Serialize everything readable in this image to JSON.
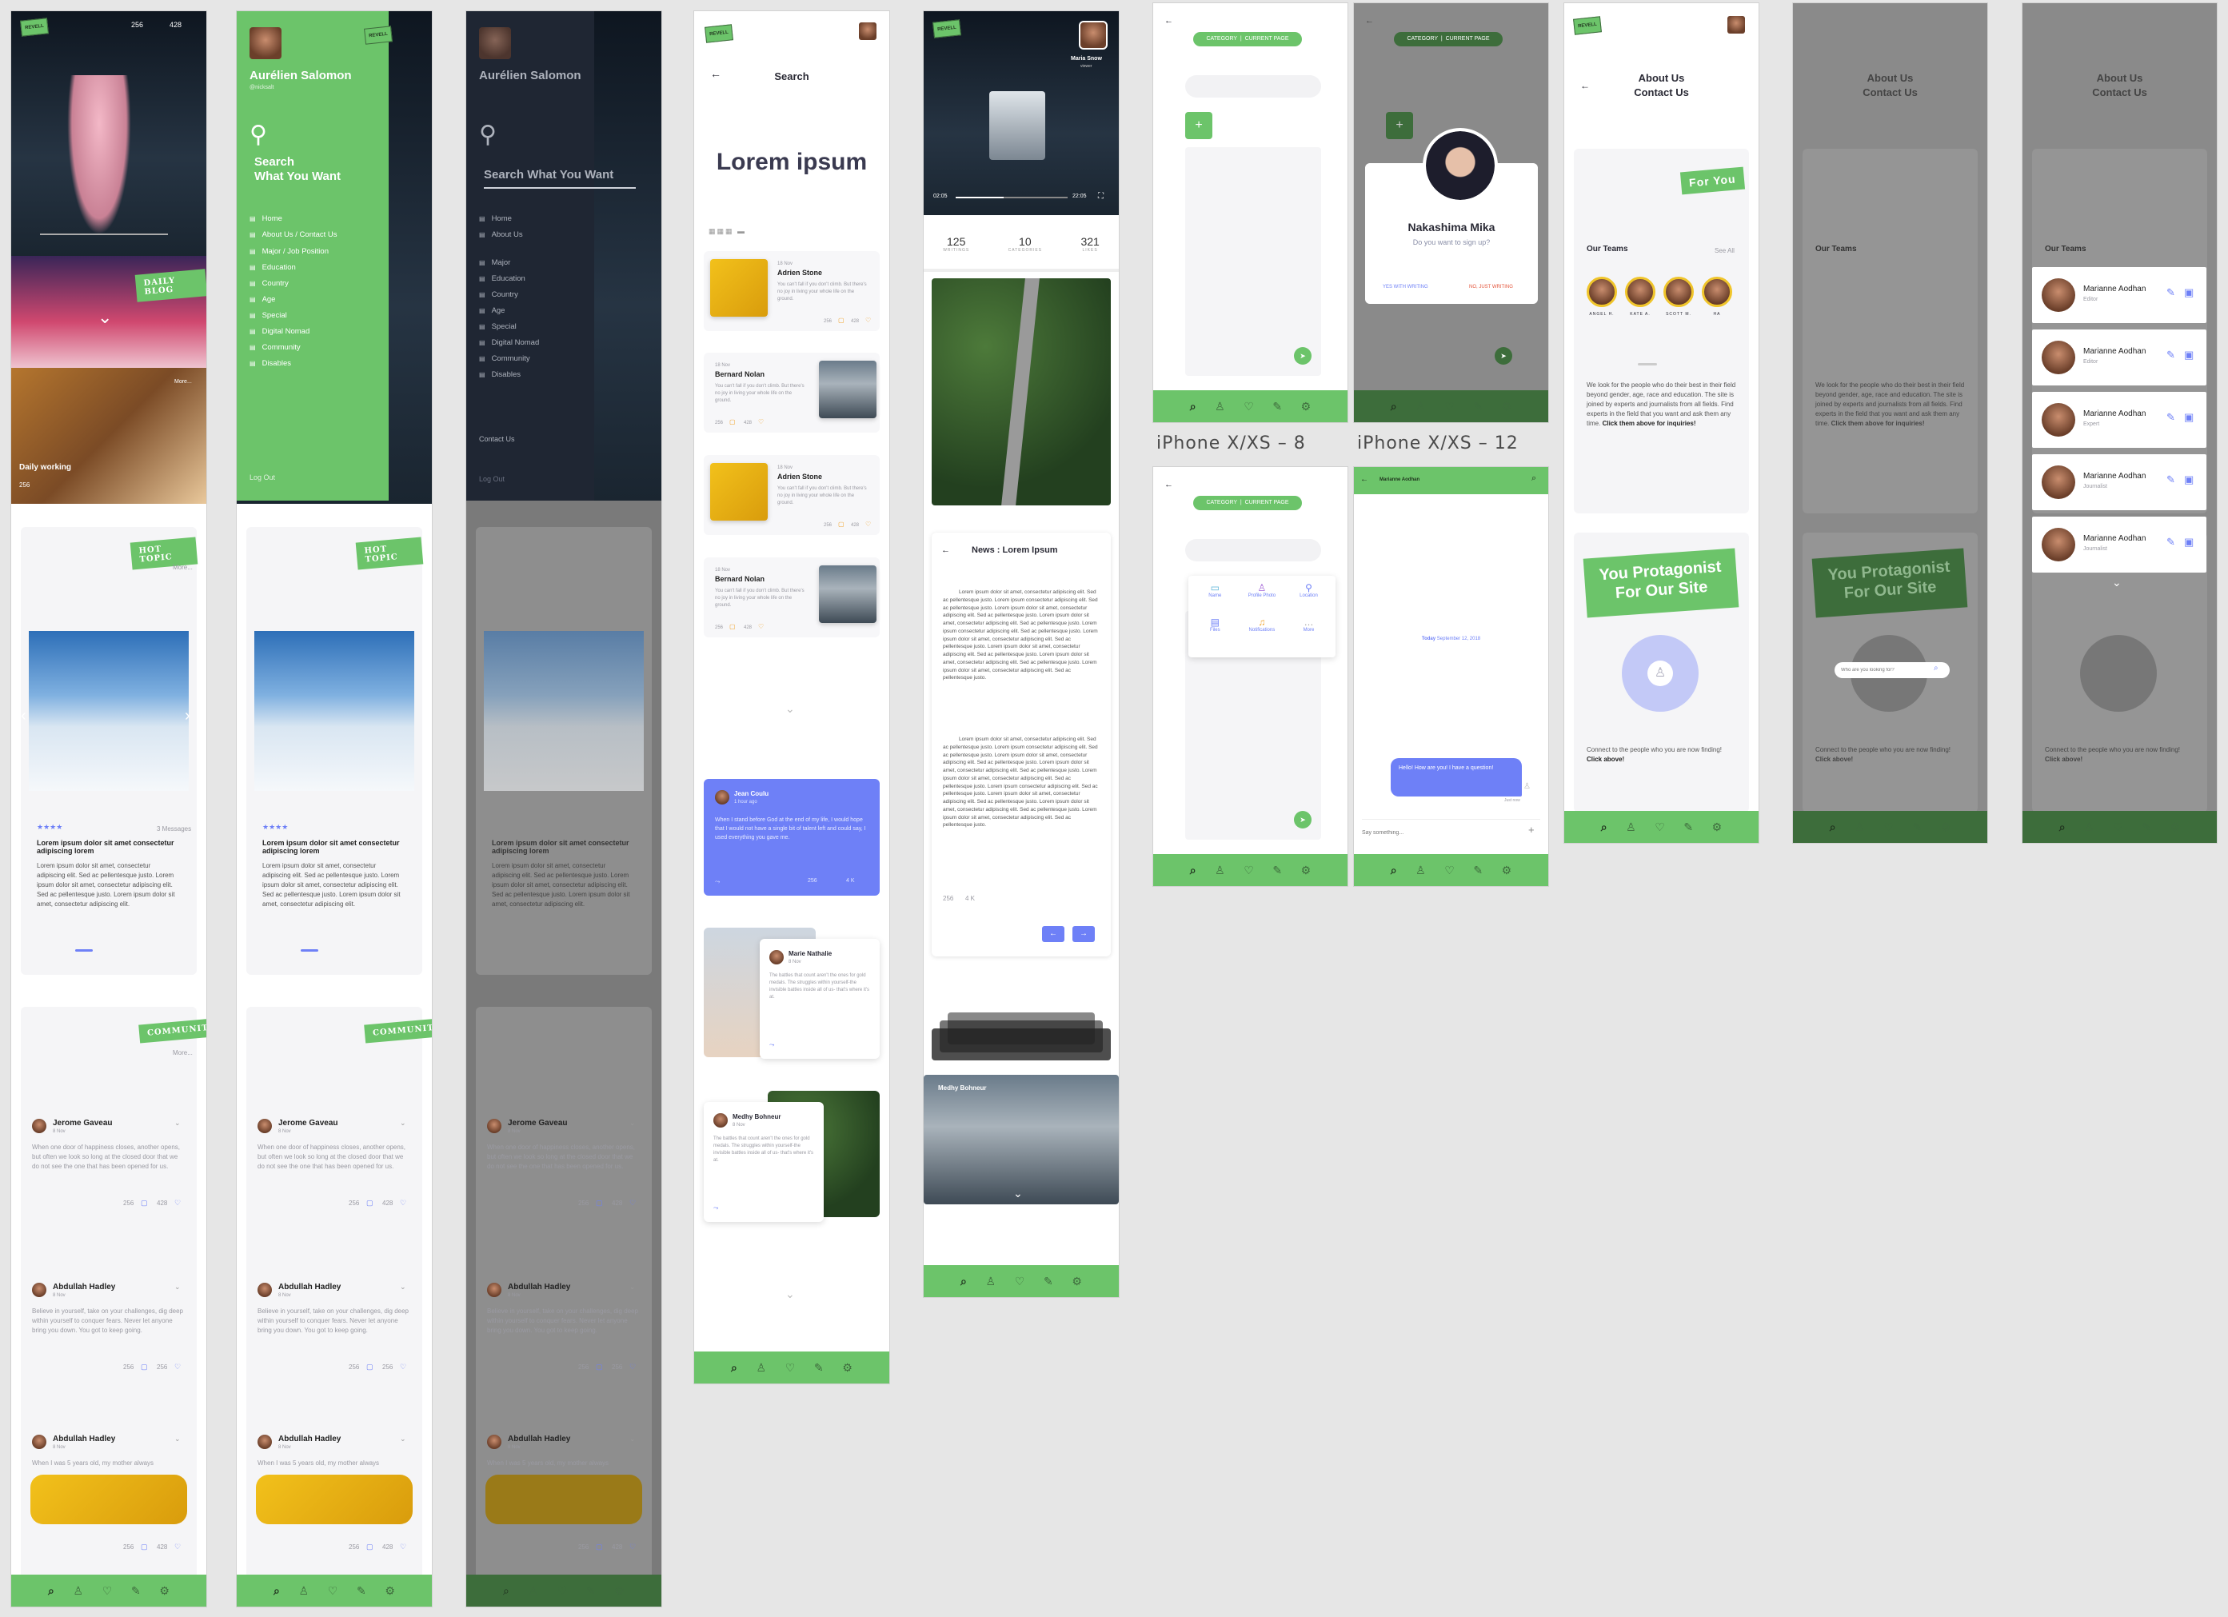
{
  "colors": {
    "brand_green": "#6cc46a",
    "accent_blue": "#6e80f7",
    "heart": "#f0a32b",
    "background": "#e6e6e6"
  },
  "app": {
    "logo": "REVELL"
  },
  "nav_icons": [
    "search-icon",
    "user-icon",
    "heart-icon",
    "edit-icon",
    "settings-icon"
  ],
  "home": {
    "likes": "256",
    "comments": "428",
    "daily_blog": "DAILY BLOG",
    "more": "More...",
    "daily_title": "Daily working",
    "hot_topic": "HOT TOPIC",
    "hot_more": "More...",
    "hot_stars": "★★★★",
    "hot_msgs": "3 Messages",
    "hot_title": "Lorem ipsum dolor sit amet consectetur adipiscing lorem",
    "hot_text": "Lorem ipsum dolor sit amet, consectetur adipiscing elit. Sed ac pellentesque justo. Lorem ipsum dolor sit amet, consectetur adipiscing elit. Sed ac pellentesque justo. Lorem ipsum dolor sit amet, consectetur adipiscing elit.",
    "community": "COMMUNITY",
    "comm_more": "More...",
    "posts": [
      {
        "name": "Jerome Gaveau",
        "date": "8 Nov",
        "text": "When one door of happiness closes, another opens, but often we look so long at the closed door that we do not see the one that has been opened for us.",
        "c": "256",
        "l": "428"
      },
      {
        "name": "Abdullah Hadley",
        "date": "8 Nov",
        "text": "Believe in yourself, take on your challenges, dig deep within yourself to conquer fears. Never let anyone bring you down. You got to keep going.",
        "c": "256",
        "l": "256"
      },
      {
        "name": "Abdullah Hadley",
        "date": "8 Nov",
        "text": "When I was 5 years old, my mother always",
        "c": "256",
        "l": "428"
      }
    ]
  },
  "menu": {
    "name": "Aurélien Salomon",
    "handle": "@nicksalt",
    "search_line1": "Search",
    "search_line2": "What You Want",
    "items": [
      "Home",
      "About Us / Contact Us",
      "Major / Job Position",
      "Education",
      "Country",
      "Age",
      "Special",
      "Digital Nomad",
      "Community",
      "Disables"
    ],
    "logout": "Log Out",
    "contact": "Contact Us"
  },
  "menu_dark": {
    "items": [
      "Home",
      "About Us",
      "Major",
      "Education",
      "Country",
      "Age",
      "Special",
      "Digital Nomad",
      "Community",
      "Disables"
    ],
    "search": "Search What You Want"
  },
  "search": {
    "title": "Search",
    "heading": "Lorem ipsum",
    "results": [
      {
        "date": "18 Nov",
        "name": "Adrien Stone",
        "text": "You can't fall if you don't climb. But there's no joy in living your whole life on the ground.",
        "c": "256",
        "l": "428"
      },
      {
        "date": "18 Nov",
        "name": "Bernard Nolan",
        "text": "You can't fall if you don't climb. But there's no joy in living your whole life on the ground.",
        "c": "256",
        "l": "428"
      },
      {
        "date": "18 Nov",
        "name": "Adrien Stone",
        "text": "You can't fall if you don't climb. But there's no joy in living your whole life on the ground.",
        "c": "256",
        "l": "428"
      },
      {
        "date": "18 Nov",
        "name": "Bernard Nolan",
        "text": "You can't fall if you don't climb. But there's no joy in living your whole life on the ground.",
        "c": "256",
        "l": "428"
      }
    ],
    "comments": [
      {
        "name": "Jean Coulu",
        "time": "1 hour ago",
        "text": "When I stand before God at the end of my life, I would hope that I would not have a single bit of talent left and could say, I used everything you gave me.",
        "c": "256",
        "l": "4 K"
      },
      {
        "name": "Marie Nathalie",
        "time": "8 Nov",
        "text": "The battles that count aren't the ones for gold medals. The struggles within yourself-the invisible battles inside all of us- that's where it's at."
      },
      {
        "name": "Medhy Bohneur",
        "time": "8 Nov",
        "text": "The battles that count aren't the ones for gold medals. The struggles within yourself-the invisible battles inside all of us- that's where it's at."
      }
    ]
  },
  "video": {
    "user": "Maria Snow",
    "sub": "viewer",
    "time_start": "02:05",
    "time_end": "22:05",
    "stats": [
      {
        "v": "125",
        "k": "WRITINGS"
      },
      {
        "v": "10",
        "k": "CATEGORIES"
      },
      {
        "v": "321",
        "k": "LIKES"
      }
    ],
    "news_title": "News : Lorem Ipsum",
    "news_p1": "Lorem ipsum dolor sit amet, consectetur adipiscing elit. Sed ac pellentesque justo. Lorem ipsum consectetur adipiscing elit. Sed ac pellentesque justo. Lorem ipsum dolor sit amet, consectetur adipiscing elit. Sed ac pellentesque justo. Lorem ipsum dolor sit amet, consectetur adipiscing elit. Sed ac pellentesque justo. Lorem ipsum consectetur adipiscing elit. Sed ac pellentesque justo. Lorem ipsum dolor sit amet, consectetur adipiscing elit. Sed ac pellentesque justo. Lorem ipsum dolor sit amet, consectetur adipiscing elit. Sed ac pellentesque justo. Lorem ipsum dolor sit amet, consectetur adipiscing elit. Sed ac pellentesque justo. Lorem ipsum dolor sit amet, consectetur adipiscing elit. Sed ac pellentesque justo.",
    "news_p2": "Lorem ipsum dolor sit amet, consectetur adipiscing elit. Sed ac pellentesque justo. Lorem ipsum consectetur adipiscing elit. Sed ac pellentesque justo. Lorem ipsum dolor sit amet, consectetur adipiscing elit. Sed ac pellentesque justo. Lorem ipsum dolor sit amet, consectetur adipiscing elit. Sed ac pellentesque justo. Lorem ipsum dolor sit amet, consectetur adipiscing elit. Sed ac pellentesque justo. Lorem ipsum consectetur adipiscing elit. Sed ac pellentesque justo. Lorem ipsum dolor sit amet, consectetur adipiscing elit. Sed ac pellentesque justo. Lorem ipsum dolor sit amet, consectetur adipiscing elit. Sed ac pellentesque justo. Lorem ipsum dolor sit amet, consectetur adipiscing elit. Sed ac pellentesque justo.",
    "news_c": "256",
    "news_l": "4 K",
    "stack_name": "Medhy Bohneur"
  },
  "editor": {
    "cat1": "CATEGORY",
    "cat2": "CURRENT PAGE",
    "label8": "iPhone X/XS – 8",
    "label12": "iPhone X/XS – 12",
    "attach": [
      {
        "icon": "chat-icon",
        "t": "Name"
      },
      {
        "icon": "profile-icon",
        "t": "Profile Photo"
      },
      {
        "icon": "location-icon",
        "t": "Location"
      },
      {
        "icon": "files-icon",
        "t": "Files"
      },
      {
        "icon": "bell-icon",
        "t": "Notifications"
      },
      {
        "icon": "more-icon",
        "t": "More"
      }
    ]
  },
  "signup": {
    "name": "Nakashima Mika",
    "q": "Do you want to sign up?",
    "yes": "YES WITH WRITING",
    "no": "NO, JUST WRITING"
  },
  "chat": {
    "name": "Marianne Aodhan",
    "today": "Today",
    "date": "September 12, 2018",
    "msg": "Hello! How are you! I have a question!",
    "meta": "Just now",
    "placeholder": "Say something..."
  },
  "about": {
    "title1": "About Us",
    "title2": "Contact Us",
    "for_you": "For You",
    "teams": "Our Teams",
    "see_all": "See All",
    "members": [
      "ANGEL H.",
      "KATE A.",
      "SCOTT M.",
      "HA"
    ],
    "desc": "We look for the people who do their best in their field beyond gender, age, race and education. The site is joined by experts and journalists from all fields. Find experts in the field that you want and ask them any time.",
    "desc_bold": "Click them above for inquiries!",
    "protagonist1": "You Protagonist",
    "protagonist2": "For Our Site",
    "connect": "Connect to the people who you are now finding!",
    "connect_bold": "Click above!",
    "search_ph": "Who are you looking for?",
    "list": [
      {
        "name": "Marianne Aodhan",
        "role": "Editor"
      },
      {
        "name": "Marianne Aodhan",
        "role": "Editor"
      },
      {
        "name": "Marianne Aodhan",
        "role": "Expert"
      },
      {
        "name": "Marianne Aodhan",
        "role": "Journalist"
      },
      {
        "name": "Marianne Aodhan",
        "role": "Journalist"
      }
    ]
  }
}
